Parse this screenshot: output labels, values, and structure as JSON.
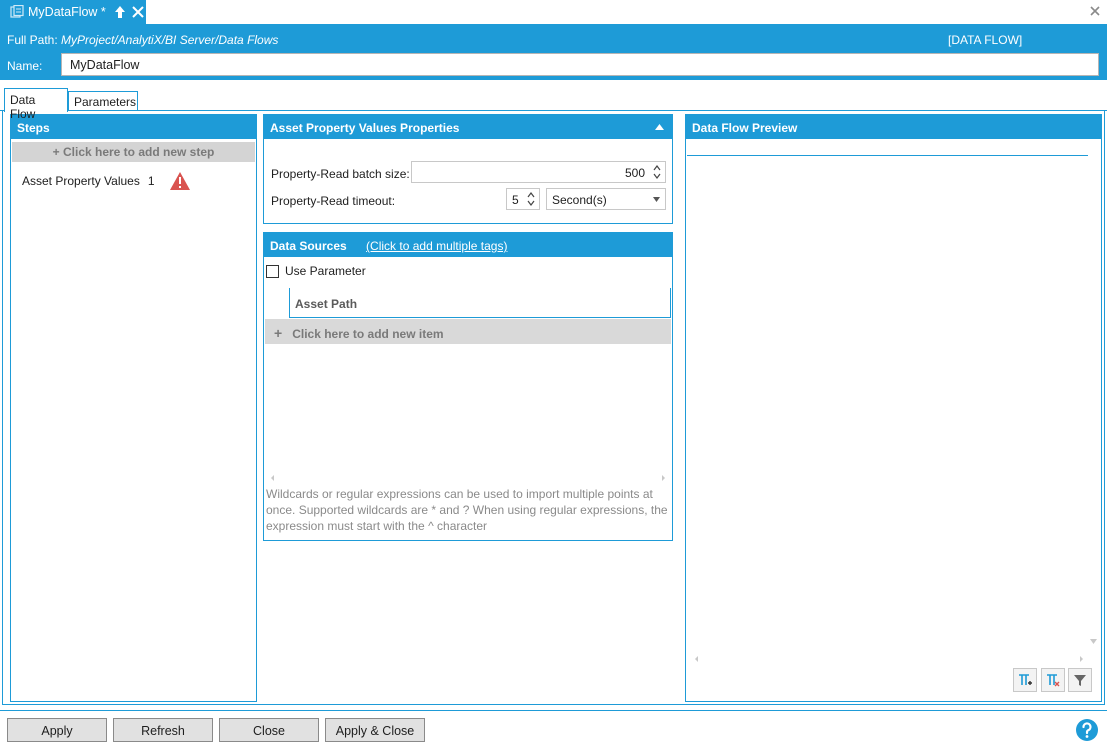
{
  "doc_tab": {
    "title": "MyDataFlow *"
  },
  "header": {
    "path_label": "Full Path:",
    "path_value": "MyProject/AnalytiX/BI Server/Data Flows",
    "type_label": "[DATA FLOW]",
    "name_label": "Name:",
    "name_value": "MyDataFlow"
  },
  "subtabs": [
    {
      "label": "Data Flow",
      "active": true
    },
    {
      "label": "Parameters",
      "active": false
    }
  ],
  "steps": {
    "title": "Steps",
    "add_label": "+ Click here to add new step",
    "items": [
      {
        "label": "Asset Property Values",
        "count": "1",
        "status": "warning-icon"
      }
    ]
  },
  "props": {
    "title": "Asset Property Values Properties",
    "batch_label": "Property-Read batch size:",
    "batch_value": "500",
    "timeout_label": "Property-Read timeout:",
    "timeout_value": "5",
    "timeout_unit": "Second(s)"
  },
  "sources": {
    "title": "Data Sources",
    "link": "(Click to add multiple tags)",
    "use_parameter": "Use Parameter",
    "column": "Asset Path",
    "add_item": "Click here to add new item",
    "add_item_icon": "+",
    "hint": "Wildcards or regular expressions can be used to import multiple points at once. Supported wildcards are * and ? When using regular expressions, the expression must start with the ^ character"
  },
  "preview": {
    "title": "Data Flow Preview"
  },
  "buttons": {
    "apply": "Apply",
    "refresh": "Refresh",
    "close": "Close",
    "apply_close": "Apply & Close"
  },
  "colors": {
    "accent": "#1e9bd7",
    "warning": "#d9534f"
  }
}
